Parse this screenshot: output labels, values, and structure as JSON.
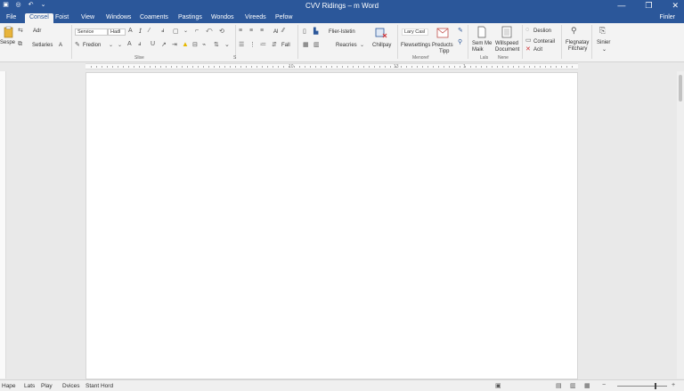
{
  "window": {
    "title": "CVV Ridings – m Word",
    "min_glyph": "—",
    "restore_glyph": "❐",
    "close_glyph": "✕"
  },
  "qat": {
    "save": "▣",
    "autosave": "◎",
    "undo": "↶",
    "redo": "⌄"
  },
  "tabs": [
    {
      "label": "File"
    },
    {
      "label": "Consel",
      "active": true
    },
    {
      "label": "Foist"
    },
    {
      "label": "View"
    },
    {
      "label": "Windows"
    },
    {
      "label": "Coaments"
    },
    {
      "label": "Pastings"
    },
    {
      "label": "Wondos"
    },
    {
      "label": "Vireeds"
    },
    {
      "label": "Pefow"
    }
  ],
  "tab_right": "Finler",
  "ribbon": {
    "clipboard": {
      "paste_label": "Sespe",
      "cut": "Adr",
      "format": "Setlaries",
      "format_arrow": "A"
    },
    "font": {
      "font_name": "Service",
      "font_size": "Hadl",
      "style_name": "Fredion",
      "group_label": "Slise"
    },
    "paragraph": {
      "group_label": "S",
      "fill_label": "Fall",
      "aa_label": "Al"
    },
    "styles": {
      "filter_label": "Flier-Istetin",
      "reaches_label": "Reacries",
      "chillpay_label": "Chillpay"
    },
    "editing": {
      "lary_label": "Lary Casl",
      "flowsettings_label": "Flewsettings",
      "products_label": "Preducts",
      "products_sub": "Tipp",
      "group_label": "Menoref"
    },
    "addins": {
      "seemo_label": "Sem Me",
      "seemo_sub": "Maik",
      "withspeed_label": "Willspeed",
      "withspeed_sub": "Document",
      "lals_label": "Lals",
      "new_label": "Nene"
    },
    "review": {
      "deslion": "Deslion",
      "comment": "Conterail",
      "ask": "Acit"
    },
    "designer": {
      "line1": "Flegnatay",
      "line2": "Fitchary"
    },
    "share": {
      "label": "Sinier"
    },
    "show_more": "⌄"
  },
  "ruler_numbers": [
    "1",
    "10",
    "13",
    "3"
  ],
  "status_bar": {
    "items": [
      "Hape",
      "Lats",
      "Play",
      "Dvices",
      "Stant Hord"
    ]
  },
  "zoom_percent": 75
}
